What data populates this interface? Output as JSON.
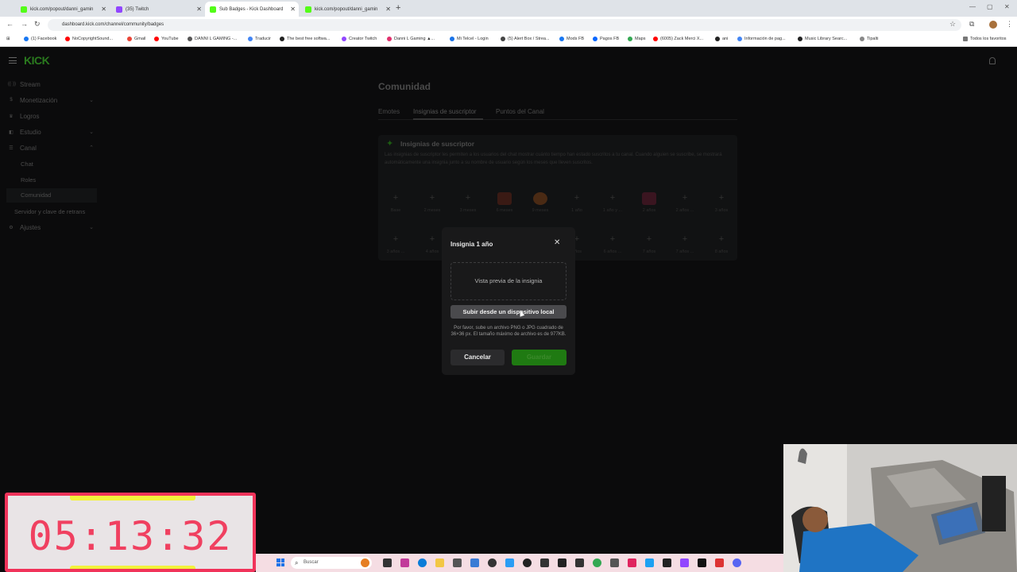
{
  "browser": {
    "tabs": [
      {
        "title": "kick.com/popout/danni_gamin",
        "favicon_color": "#53fc18",
        "active": false
      },
      {
        "title": "(35) Twitch",
        "favicon_color": "#9146ff",
        "active": false
      },
      {
        "title": "Sub Badges - Kick Dashboard",
        "favicon_color": "#53fc18",
        "active": true
      },
      {
        "title": "kick.com/popout/danni_gamin",
        "favicon_color": "#53fc18",
        "active": false
      }
    ],
    "new_tab": "+",
    "url": "dashboard.kick.com/channel/community/badges",
    "bookmarks": [
      {
        "label": "(1) Facebook",
        "color": "#1877f2"
      },
      {
        "label": "NoCopyrightSound...",
        "color": "#ff0000"
      },
      {
        "label": "Gmail",
        "color": "#ea4335"
      },
      {
        "label": "YouTube",
        "color": "#ff0000"
      },
      {
        "label": "DANNI L GAMING -...",
        "color": "#555555"
      },
      {
        "label": "Traducir",
        "color": "#4285f4"
      },
      {
        "label": "The best free softwa...",
        "color": "#222222"
      },
      {
        "label": "Creator Twitch",
        "color": "#9146ff"
      },
      {
        "label": "Danni L Gaming ▲...",
        "color": "#e1306c"
      },
      {
        "label": "Mi Telcel - Login",
        "color": "#1a73e8"
      },
      {
        "label": "(5) Alert Box / Strea...",
        "color": "#444444"
      },
      {
        "label": "Mods FB",
        "color": "#1877f2"
      },
      {
        "label": "Pagos FB",
        "color": "#0866ff"
      },
      {
        "label": "Maps",
        "color": "#34a853"
      },
      {
        "label": "(6005) Zack Merci X...",
        "color": "#ff0000"
      },
      {
        "label": "ani",
        "color": "#222222"
      },
      {
        "label": "Información de pag...",
        "color": "#4285f4"
      },
      {
        "label": "Music Library Searc...",
        "color": "#222222"
      },
      {
        "label": "Tipalti",
        "color": "#888888"
      },
      {
        "label": "Todos los favoritos",
        "color": "#777777"
      }
    ]
  },
  "app": {
    "logo": "KICK",
    "sidebar": {
      "items": [
        {
          "label": "Stream",
          "icon": "broadcast-icon"
        },
        {
          "label": "Monetización",
          "icon": "money-icon",
          "expandable": true
        },
        {
          "label": "Logros",
          "icon": "trophy-icon"
        },
        {
          "label": "Estudio",
          "icon": "studio-icon",
          "expandable": true
        },
        {
          "label": "Canal",
          "icon": "channel-icon",
          "expanded": true
        }
      ],
      "sub_items": [
        "Chat",
        "Roles",
        "Comunidad"
      ],
      "active_sub": "Comunidad",
      "server_item": "Servidor y clave de retrans",
      "settings_item": "Ajustes"
    },
    "page_title": "Comunidad",
    "tabs": [
      "Emotes",
      "Insignias de suscriptor",
      "Puntos del Canal"
    ],
    "active_tab": "Insignias de suscriptor",
    "badges_card": {
      "title": "Insignias de suscriptor",
      "description": "Las insignias de suscriptor les permiten a los usuarios del chat mostrar cuánto tiempo han estado suscritos a tu canal. Cuando alguien se suscribe, se mostrará automáticamente una insignia junto a su nombre de usuario según los meses que lleven suscritos.",
      "row1": [
        {
          "label": "Base",
          "filled": false
        },
        {
          "label": "2 meses",
          "filled": false
        },
        {
          "label": "3 meses",
          "filled": false
        },
        {
          "label": "6 meses",
          "filled": true,
          "color": "#3a1a14"
        },
        {
          "label": "9 meses",
          "filled": true,
          "color": "#4a2a14"
        },
        {
          "label": "1 año",
          "filled": false
        },
        {
          "label": "1 año y ...",
          "filled": false
        },
        {
          "label": "2 años",
          "filled": true,
          "color": "#3a1520"
        },
        {
          "label": "2 años ...",
          "filled": false
        },
        {
          "label": "3 años",
          "filled": false
        }
      ],
      "row2": [
        {
          "label": "3 años ...",
          "filled": false
        },
        {
          "label": "4 años",
          "filled": false
        },
        {
          "label": "",
          "filled": false
        },
        {
          "label": "",
          "filled": false
        },
        {
          "label": "",
          "filled": false
        },
        {
          "label": "años",
          "filled": false
        },
        {
          "label": "6 años ...",
          "filled": false
        },
        {
          "label": "7 años",
          "filled": false
        },
        {
          "label": "7 años ...",
          "filled": false
        },
        {
          "label": "8 años",
          "filled": false
        }
      ]
    },
    "modal": {
      "title": "Insignia 1 año",
      "preview_label": "Vista previa de la insignia",
      "upload_button": "Subir desde un dispositivo local",
      "upload_hint": "Por favor, sube un archivo PNG o JPG cuadrado de 36×36 px. El tamaño máximo de archivo es de 977KB.",
      "cancel_button": "Cancelar",
      "save_button": "Guardar"
    }
  },
  "overlay": {
    "timer": "05:13:32",
    "taskbar_search": "Buscar"
  },
  "colors": {
    "kick_green": "#53fc18",
    "timer_border": "#f1335a",
    "timer_text": "#f04060",
    "timer_accent": "#f2f23a",
    "save_green": "#1f7a12"
  }
}
